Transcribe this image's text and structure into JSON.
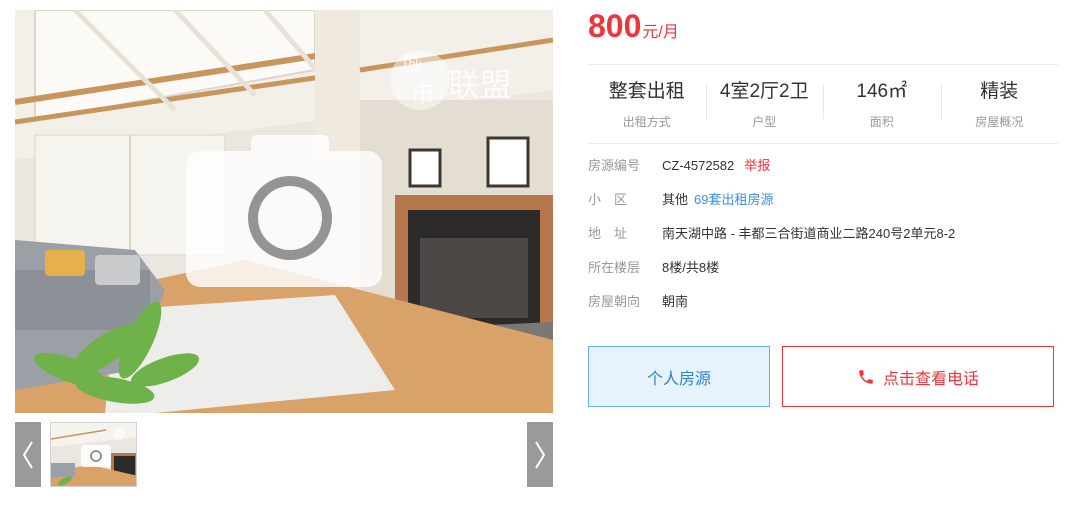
{
  "listing": {
    "price": {
      "value": "800",
      "unit": "元/月"
    },
    "summary": [
      {
        "value": "整套出租",
        "label": "出租方式"
      },
      {
        "value": "4室2厅2卫",
        "label": "户型"
      },
      {
        "value": "146㎡",
        "label": "面积"
      },
      {
        "value": "精装",
        "label": "房屋概况"
      }
    ],
    "details": {
      "code": {
        "label": "房源编号",
        "value": "CZ-4572582",
        "report_link": "举报"
      },
      "community": {
        "label": "小　区",
        "value": "其他",
        "link": "69套出租房源"
      },
      "address": {
        "label": "地　址",
        "value": "南天湖中路 - 丰都三合街道商业二路240号2单元8-2"
      },
      "floor": {
        "label": "所在楼层",
        "value": "8楼/共8楼"
      },
      "orientation": {
        "label": "房屋朝向",
        "value": "朝南"
      }
    },
    "actions": {
      "personal_label": "个人房源",
      "phone_label": "点击查看电话"
    }
  },
  "gallery": {
    "watermark_text": "城市联盟",
    "thumb_count": 1,
    "placeholder_icon": "camera-icon"
  },
  "colors": {
    "accent_red": "#f1333a",
    "link_blue": "#3b8ee5",
    "personal_bg": "#e6f3fc",
    "personal_border": "#67b1ec"
  }
}
